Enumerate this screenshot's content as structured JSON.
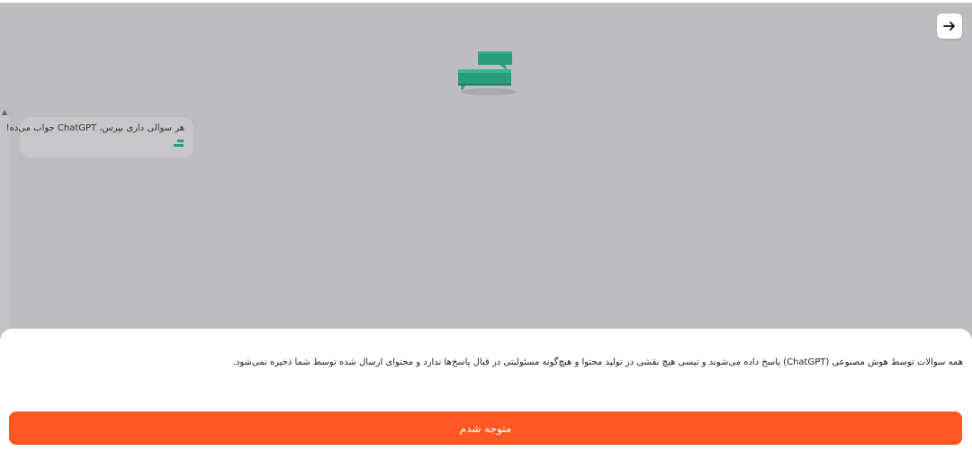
{
  "header": {
    "back_icon": "arrow-right-icon"
  },
  "brand": {
    "logo_icon": "chat-bubbles-logo-icon",
    "accent_color": "#2a9d7b"
  },
  "chat": {
    "welcome_message": "هر سوالی داری بپرس، ChatGPT جواب می‌ده!",
    "message_icon": "chat-bubbles-small-icon"
  },
  "disclaimer": {
    "text": "همه سوالات توسط هوش مصنوعی (ChatGPT) پاسخ داده می‌شوند و تپسی هیچ نقشی در تولید محتوا و هیچ‌گونه مسئولیتی در قبال پاسخ‌ها ندارد و محتوای ارسال شده توسط شما ذخیره نمی‌شود.",
    "confirm_label": "متوجه شدم",
    "button_color": "#ff5722"
  }
}
